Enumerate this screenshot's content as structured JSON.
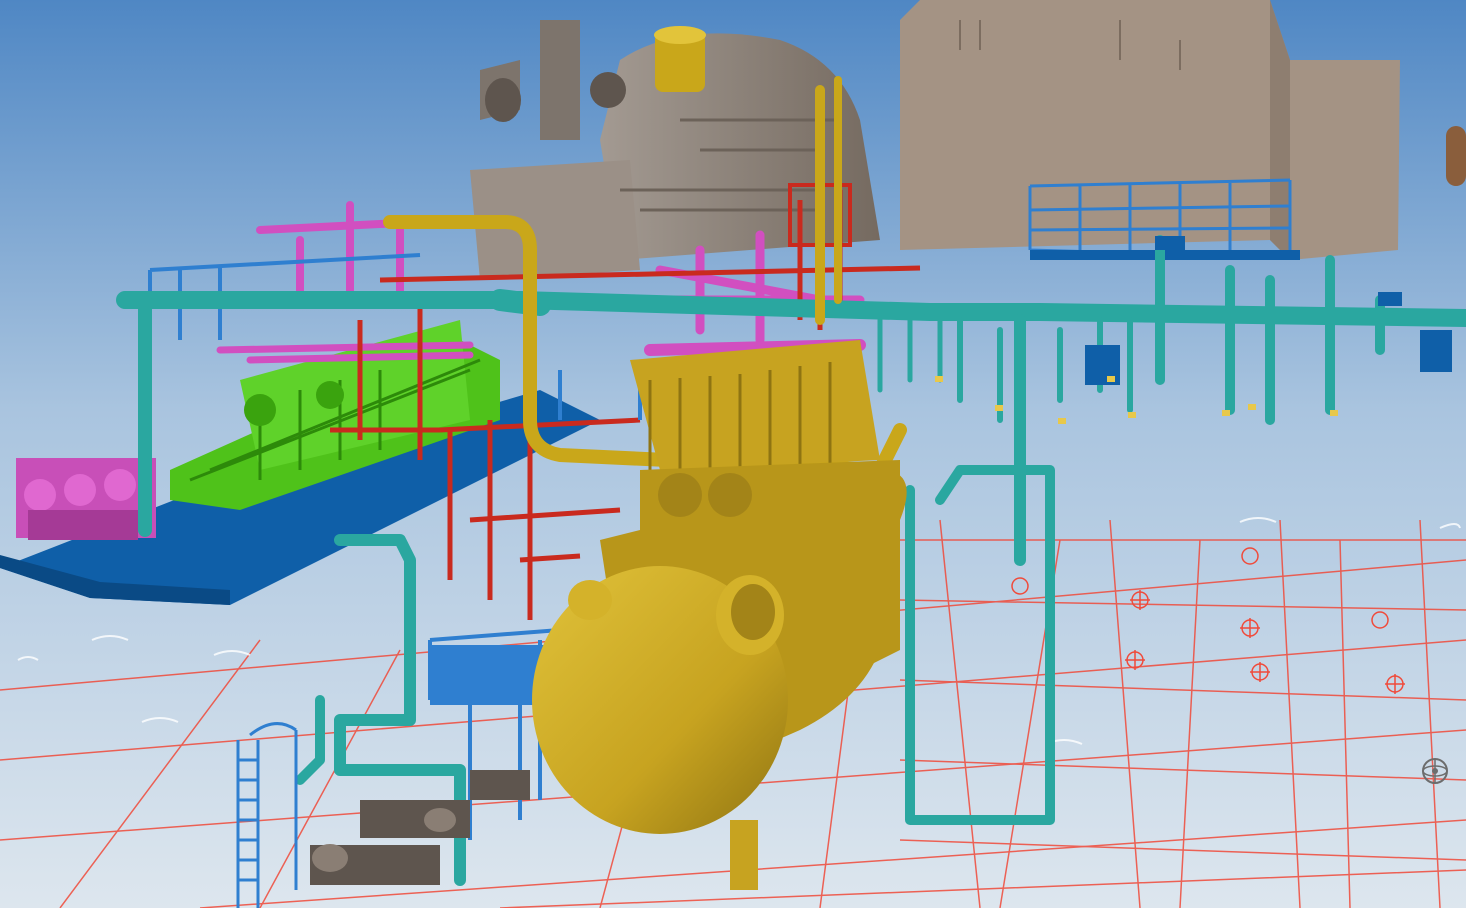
{
  "viewport": {
    "background": {
      "top": "#4f87c4",
      "mid": "#a9c4df",
      "bottom": "#dde6ee"
    }
  },
  "colors": {
    "steel_structure": "#0f5fa8",
    "steel_structure_light": "#2f7fd0",
    "cooling_water_pipe": "#2aa7a0",
    "oil_system_pipe": "#d14fc0",
    "steam_pipe": "#c92a1e",
    "condenser_vessel": "#c7a320",
    "condenser_vessel_shadow": "#8f7412",
    "lube_oil_skid": "#4fc21a",
    "turbine_casing": "#8c8076",
    "generator_building": "#a49384",
    "floor_grid": "#f04a3a",
    "pump_motor": "#6e6257"
  },
  "icons": {
    "orbit_tool": "orbit-icon"
  }
}
